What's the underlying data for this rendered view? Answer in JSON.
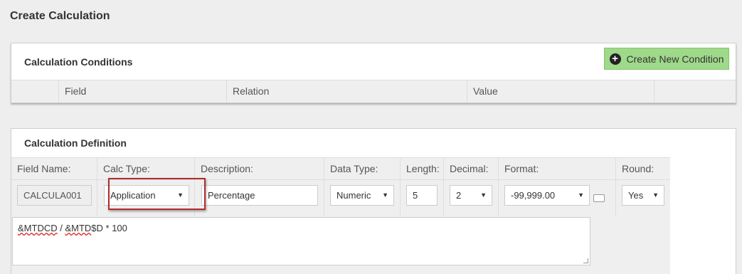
{
  "page": {
    "title": "Create Calculation"
  },
  "conditions": {
    "title": "Calculation Conditions",
    "create_button": "Create New Condition",
    "columns": [
      "Field",
      "Relation",
      "Value"
    ]
  },
  "definition": {
    "title": "Calculation Definition",
    "labels": {
      "field_name": "Field Name:",
      "calc_type": "Calc Type:",
      "description": "Description:",
      "data_type": "Data Type:",
      "length": "Length:",
      "decimal": "Decimal:",
      "format": "Format:",
      "round": "Round:"
    },
    "values": {
      "field_name": "CALCULA001",
      "calc_type": "Application",
      "description": "Percentage",
      "data_type": "Numeric",
      "length": "5",
      "decimal": "2",
      "format": "-99,999.00",
      "round": "Yes"
    },
    "expression": {
      "token1": "&MTDCD",
      "sep1": " / ",
      "token2": "&MTD",
      "rest": "$D * 100"
    }
  },
  "colors": {
    "highlight": "#b22b2b",
    "create_button_bg": "#9fd98a"
  }
}
